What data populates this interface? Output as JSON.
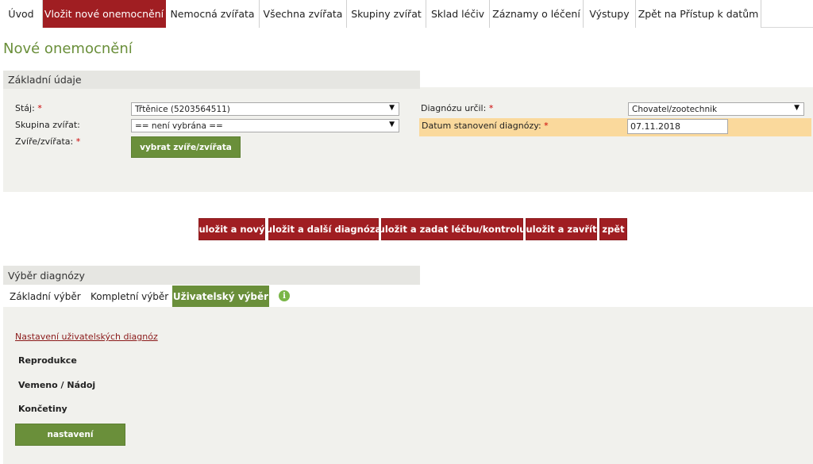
{
  "nav": {
    "tabs": [
      {
        "label": "Úvod"
      },
      {
        "label": "Vložit nové onemocnění"
      },
      {
        "label": "Nemocná zvířata"
      },
      {
        "label": "Všechna zvířata"
      },
      {
        "label": "Skupiny zvířat"
      },
      {
        "label": "Sklad léčiv"
      },
      {
        "label": "Záznamy o léčení"
      },
      {
        "label": "Výstupy"
      },
      {
        "label": "Zpět na Přístup k datům"
      }
    ],
    "active_index": 1
  },
  "page_title": "Nové onemocnění",
  "basic": {
    "heading": "Základní údaje",
    "stable_label": "Stáj:",
    "stable_value": "Třtěnice (5203564511)",
    "group_label": "Skupina zvířat:",
    "group_value": "== není vybrána ==",
    "animals_label": "Zvíře/zvířata:",
    "select_animals_button": "vybrat zvíře/zvířata",
    "diagnosed_by_label": "Diagnózu určil:",
    "diagnosed_by_value": "Chovatel/zootechnik",
    "diagnosis_date_label": "Datum stanovení diagnózy:",
    "diagnosis_date_value": "07.11.2018",
    "required_mark": "*"
  },
  "actions": {
    "save_new": "uložit a nový",
    "save_next_diagnosis": "uložit a další diagnóza",
    "save_treatment": "uložit a zadat léčbu/kontrolu",
    "save_close": "uložit a zavřít",
    "back": "zpět"
  },
  "diagnosis": {
    "heading": "Výběr diagnózy",
    "tabs": [
      {
        "label": "Základní výběr"
      },
      {
        "label": "Kompletní výběr"
      },
      {
        "label": "Uživatelský výběr"
      }
    ],
    "active_tab": 2,
    "info_icon": "info-icon",
    "settings_link": "Nastavení uživatelských diagnóz",
    "items": [
      {
        "label": "Reprodukce"
      },
      {
        "label": "Vemeno / Nádoj"
      },
      {
        "label": "Končetiny"
      }
    ],
    "settings_button": "nastavení"
  },
  "colors": {
    "accent_red": "#a01e22",
    "accent_green": "#6a8f3a",
    "highlight": "#fad99c",
    "panel_bg": "#f1f1ed"
  }
}
